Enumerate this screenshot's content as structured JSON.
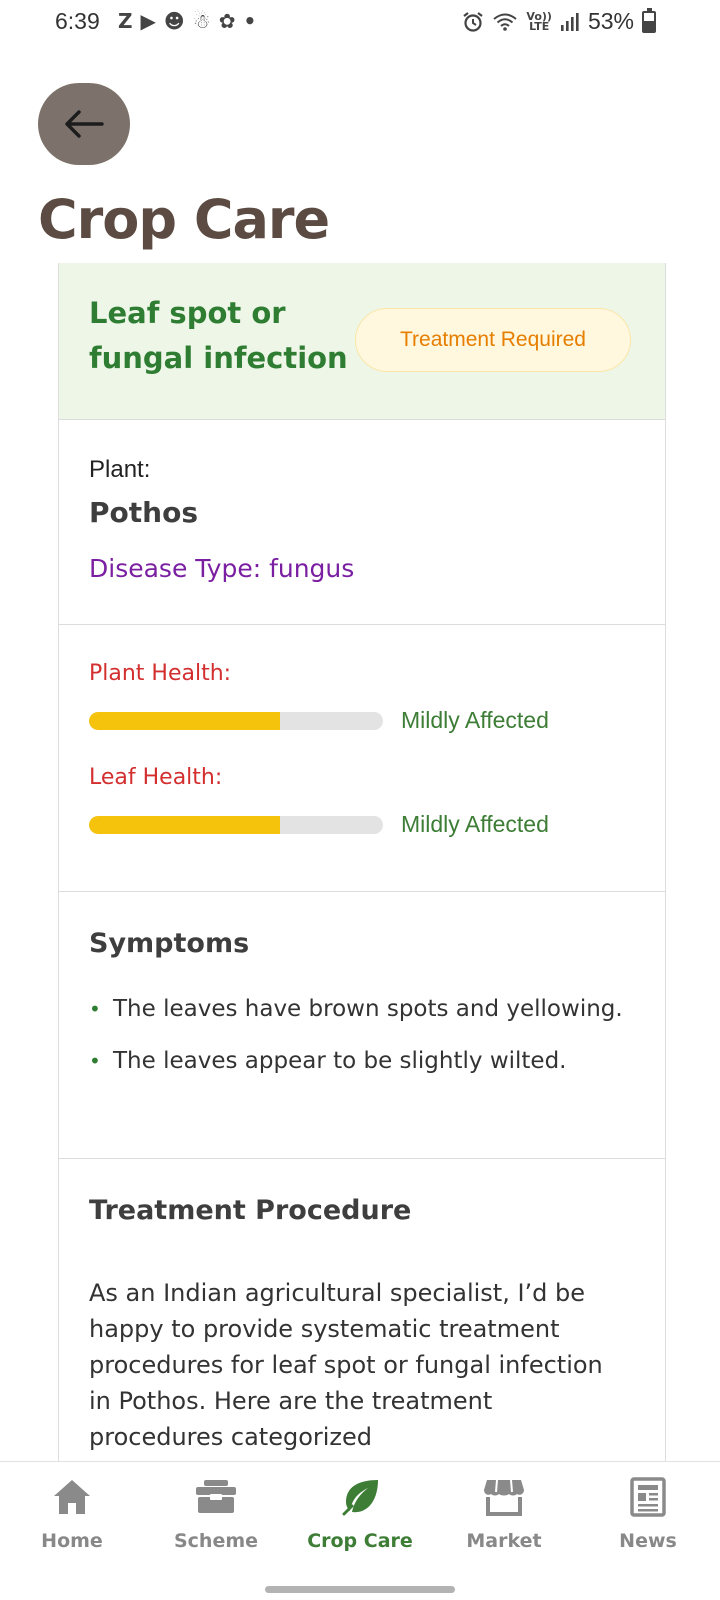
{
  "status_bar": {
    "time": "6:39",
    "left_icons": [
      "Z",
      "▶",
      "☻",
      "☃",
      "✿",
      "•"
    ],
    "right_icons": [
      "alarm-icon",
      "wifi-icon",
      "lte-icon",
      "signal-icon"
    ],
    "lte_label": "Vo)) LTE",
    "battery": "53%"
  },
  "header": {
    "back_icon": "arrow-left-icon",
    "title": "Crop Care"
  },
  "diagnosis": {
    "disease_name": "Leaf spot or fungal infection",
    "badge": "Treatment Required",
    "plant_label": "Plant:",
    "plant_name": "Pothos",
    "disease_type": "Disease Type: fungus"
  },
  "health": {
    "plant_label": "Plant Health:",
    "plant_level": 0.65,
    "plant_status": "Mildly Affected",
    "leaf_label": "Leaf Health:",
    "leaf_level": 0.65,
    "leaf_status": "Mildly Affected"
  },
  "symptoms": {
    "title": "Symptoms",
    "items": [
      "The leaves have brown spots and yellowing.",
      "The leaves appear to be slightly wilted."
    ]
  },
  "treatment": {
    "title": "Treatment Procedure",
    "text": "As an Indian agricultural specialist, I’d be happy to provide systematic treatment procedures for leaf spot or fungal infection in Pothos. Here are the treatment procedures categorized"
  },
  "bottom_nav": {
    "items": [
      {
        "label": "Home",
        "icon": "home-icon",
        "active": false
      },
      {
        "label": "Scheme",
        "icon": "briefcase-icon",
        "active": false
      },
      {
        "label": "Crop Care",
        "icon": "leaf-icon",
        "active": true
      },
      {
        "label": "Market",
        "icon": "store-icon",
        "active": false
      },
      {
        "label": "News",
        "icon": "newspaper-icon",
        "active": false
      }
    ]
  },
  "colors": {
    "accent_green": "#3d7d36",
    "title_brown": "#5b4b42",
    "badge_orange": "#e67e00",
    "health_red": "#d32f2f",
    "bar_yellow": "#f5c30b",
    "disease_purple": "#7b1fa2"
  }
}
